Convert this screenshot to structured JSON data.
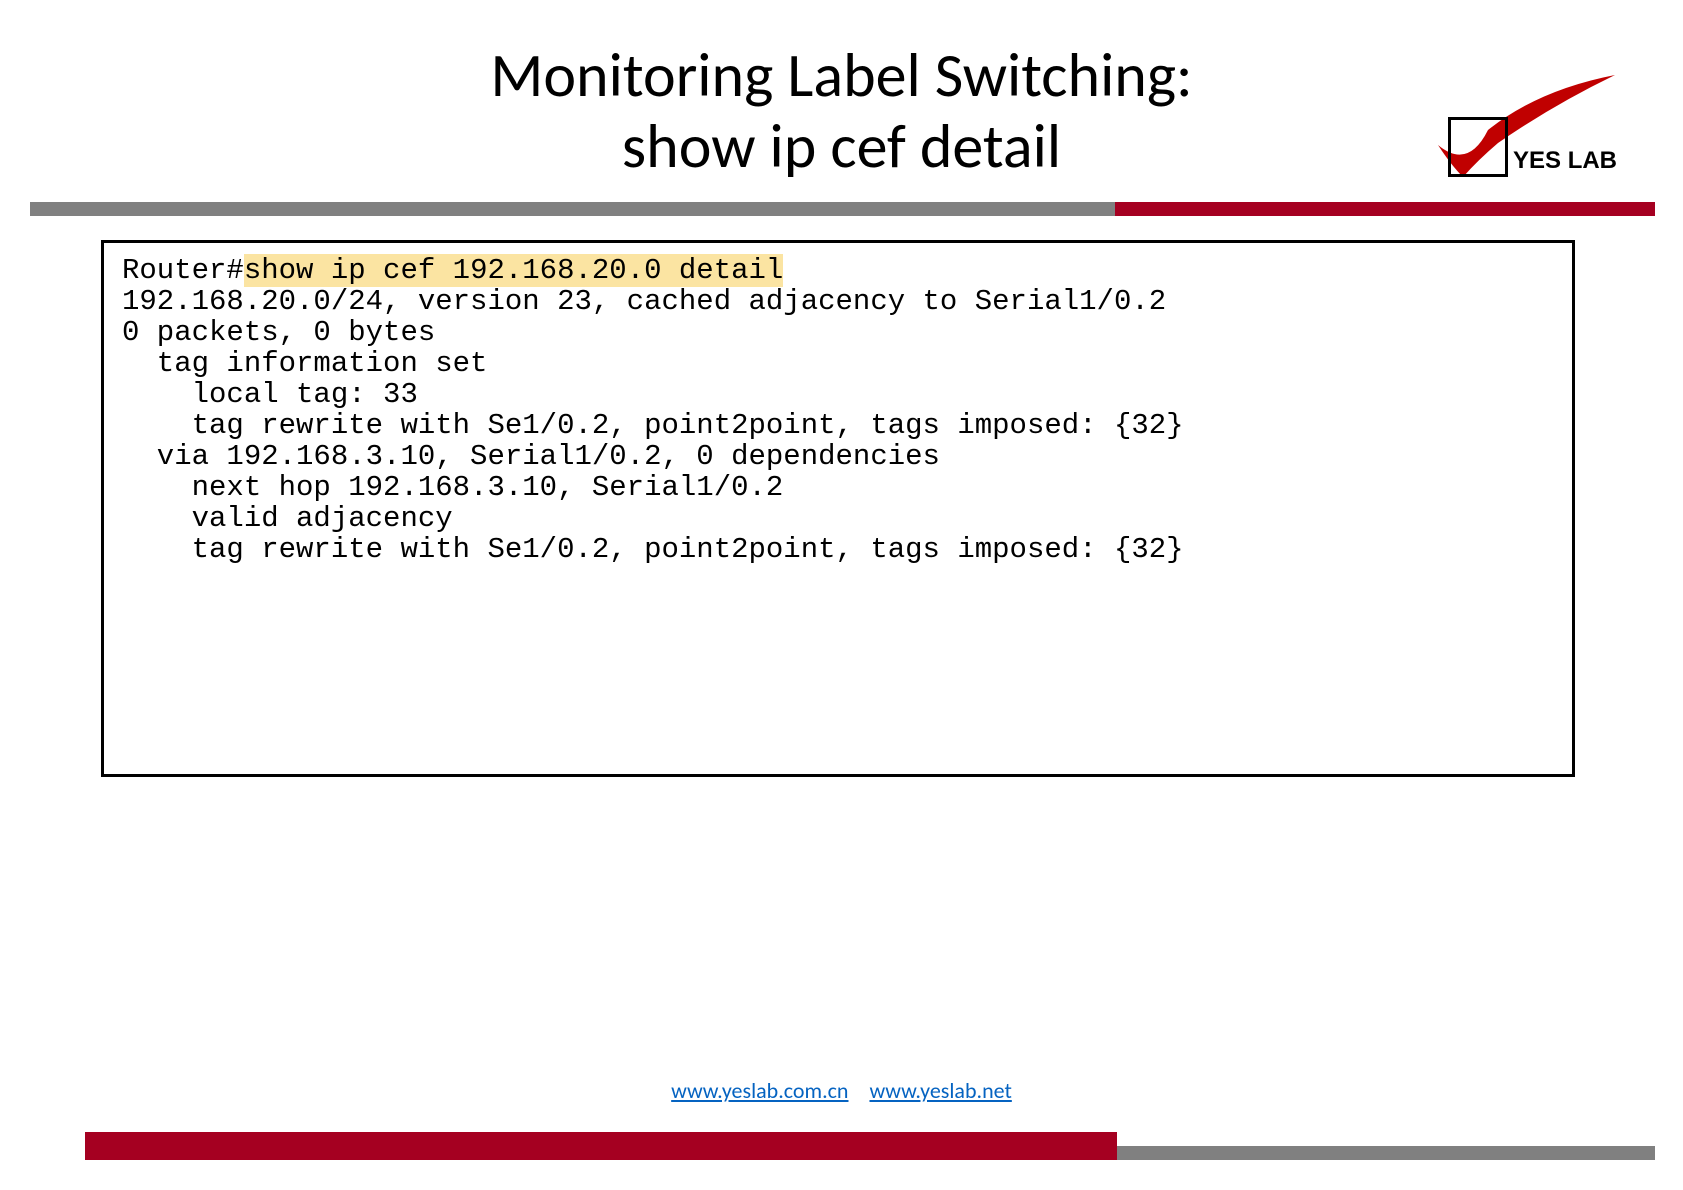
{
  "title": {
    "line1": "Monitoring Label Switching:",
    "line2": "show ip cef detail"
  },
  "logo": {
    "text": "YES LAB"
  },
  "code": {
    "prompt": "Router#",
    "command": "show ip cef 192.168.20.0 detail",
    "body": "192.168.20.0/24, version 23, cached adjacency to Serial1/0.2\n0 packets, 0 bytes\n  tag information set\n    local tag: 33\n    tag rewrite with Se1/0.2, point2point, tags imposed: {32}\n  via 192.168.3.10, Serial1/0.2, 0 dependencies\n    next hop 192.168.3.10, Serial1/0.2\n    valid adjacency\n    tag rewrite with Se1/0.2, point2point, tags imposed: {32}"
  },
  "footer": {
    "link1": "www.yeslab.com.cn",
    "link2": "www.yeslab.net"
  }
}
